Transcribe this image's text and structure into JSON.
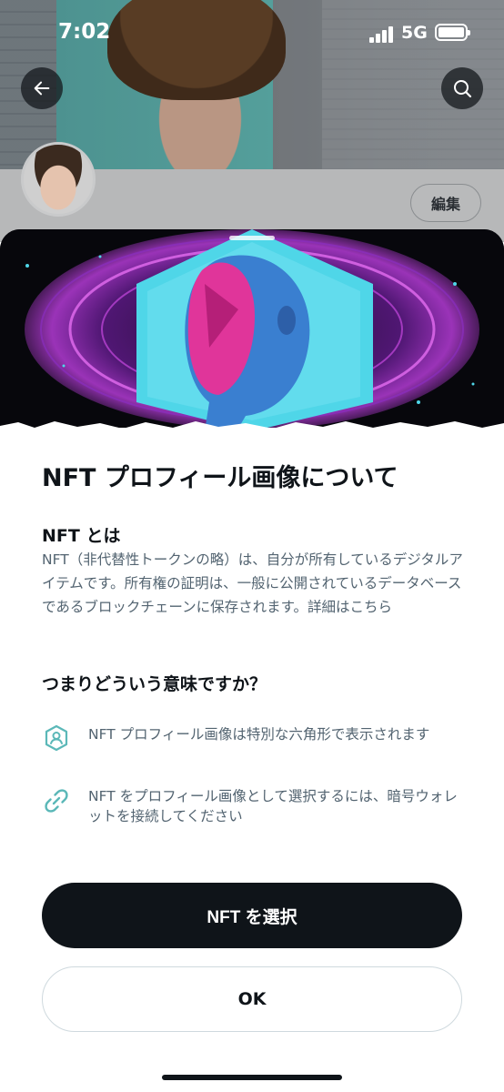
{
  "status_bar": {
    "time": "7:02",
    "network": "5G"
  },
  "profile": {
    "edit_label": "編集"
  },
  "sheet": {
    "title": "NFT プロフィール画像について",
    "what_is_heading": "NFT とは",
    "what_is_body": "NFT（非代替性トークンの略）は、自分が所有しているデジタルアイテムです。所有権の証明は、一般に公開されているデータベースであるブロックチェーンに保存されます。詳細はこちら",
    "meaning_heading": "つまりどういう意味ですか？",
    "features": [
      {
        "icon": "hexagon-user-icon",
        "text": "NFT プロフィール画像は特別な六角形で表示されます"
      },
      {
        "icon": "link-icon",
        "text": "NFT をプロフィール画像として選択するには、暗号ウォレットを接続してください"
      }
    ],
    "primary_button": "NFT を選択",
    "secondary_button": "OK"
  },
  "colors": {
    "primary": "#0f1419",
    "secondary_text": "#536471",
    "accent_teal": "#5bb8b8",
    "art_cyan": "#4fd6e8",
    "art_magenta": "#e0359a"
  }
}
